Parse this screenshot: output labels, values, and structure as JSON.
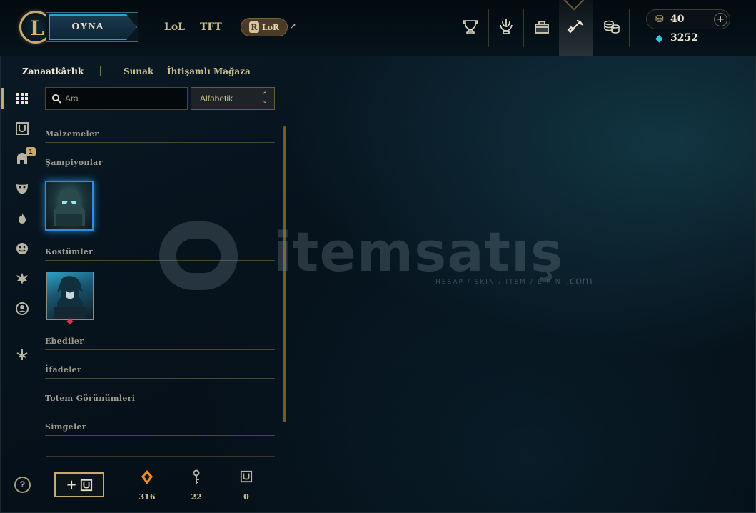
{
  "topbar": {
    "play_label": "OYNA",
    "nav": [
      "LoL",
      "TFT"
    ],
    "lor_label": "LoR",
    "lor_badge": "R",
    "external_arrow": "↗",
    "icons": [
      "trophy-icon",
      "honor-icon",
      "inventory-icon",
      "crafting-icon",
      "store-icon"
    ],
    "rp_value": "40",
    "plus": "+",
    "be_value": "3252"
  },
  "subnav": {
    "items": [
      "Zanaatkârlık",
      "Sunak",
      "İhtişamlı Mağaza"
    ],
    "active": "Zanaatkârlık"
  },
  "rail": {
    "icons": [
      "grid-icon",
      "chest-icon",
      "helmet-icon",
      "mask-icon",
      "flame-icon",
      "emote-icon",
      "ward-icon",
      "profile-icon",
      "tft-icon"
    ],
    "badge": "1"
  },
  "search": {
    "placeholder": "Ara"
  },
  "sort": {
    "value": "Alfabetik",
    "arrows_up": "⌃",
    "arrows_down": "⌄"
  },
  "categories": {
    "materials": "Malzemeler",
    "champions": "Şampiyonlar",
    "skins": "Kostümler",
    "eternals": "Ebediler",
    "emotes": "İfadeler",
    "ward_skins": "Totem Görünümleri",
    "icons": "Simgeler"
  },
  "footer": {
    "help": "?",
    "add_chest": "+",
    "essence_orange": "316",
    "keys": "22",
    "chests": "0"
  },
  "watermark": {
    "text": "itemsatış",
    "sub": "HESAP / SKIN / ITEM / E-PIN",
    "com": ".com"
  },
  "colors": {
    "gold": "#c8aa6e",
    "accent_blue": "#1ea8c8",
    "essence_orange": "#f08a28"
  }
}
